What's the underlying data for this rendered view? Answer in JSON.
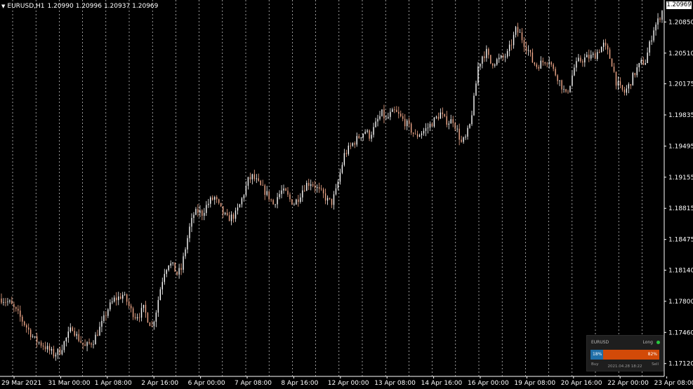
{
  "header": {
    "arrow_icon": "triangle-down-icon",
    "symbol": "EURUSD,H1",
    "open": "1.20990",
    "high": "1.20996",
    "low": "1.20937",
    "close": "1.20969"
  },
  "current_price": "1.20969",
  "colors": {
    "background": "#000000",
    "bull_candle": "#ffffff",
    "bear_candle": "#f2a98a",
    "grid": "#ffffff",
    "buy_bar": "#1f6fa8",
    "sell_bar": "#d24a08",
    "long_dot": "#27c93f"
  },
  "widget": {
    "symbol": "EURUSD",
    "signal_label": "Long",
    "buy_pct": "18%",
    "sell_pct": "82%",
    "buy_fraction": 0.18,
    "buy_label": "Buy",
    "sell_label": "Sell",
    "timestamp": "2021.04.28 18:22"
  },
  "chart_data": {
    "type": "candlestick",
    "symbol": "EURUSD",
    "timeframe": "H1",
    "ylim": [
      1.1698,
      1.2109
    ],
    "grid": "vertical dotted",
    "y_ticks": [
      "1.20850",
      "1.20510",
      "1.20175",
      "1.19835",
      "1.19495",
      "1.19155",
      "1.18815",
      "1.18475",
      "1.18140",
      "1.17800",
      "1.17460",
      "1.17120"
    ],
    "x_ticks": [
      "29 Mar 2021",
      "31 Mar 00:00",
      "1 Apr 08:00",
      "2 Apr 16:00",
      "6 Apr 00:00",
      "7 Apr 08:00",
      "8 Apr 16:00",
      "12 Apr 00:00",
      "13 Apr 08:00",
      "14 Apr 16:00",
      "16 Apr 00:00",
      "19 Apr 08:00",
      "20 Apr 16:00",
      "22 Apr 00:00",
      "23 Apr 08:00"
    ],
    "close_path": [
      [
        0,
        1.1783
      ],
      [
        4,
        1.1778
      ],
      [
        8,
        1.1766
      ],
      [
        12,
        1.1752
      ],
      [
        16,
        1.1738
      ],
      [
        20,
        1.1732
      ],
      [
        25,
        1.1722
      ],
      [
        28,
        1.1726
      ],
      [
        30,
        1.1735
      ],
      [
        34,
        1.1752
      ],
      [
        36,
        1.1742
      ],
      [
        40,
        1.173
      ],
      [
        44,
        1.1737
      ],
      [
        48,
        1.1755
      ],
      [
        51,
        1.1772
      ],
      [
        54,
        1.1782
      ],
      [
        56,
        1.1784
      ],
      [
        58,
        1.1787
      ],
      [
        60,
        1.178
      ],
      [
        62,
        1.177
      ],
      [
        64,
        1.1764
      ],
      [
        66,
        1.1766
      ],
      [
        68,
        1.1772
      ],
      [
        70,
        1.1761
      ],
      [
        72,
        1.1752
      ],
      [
        74,
        1.177
      ],
      [
        76,
        1.1794
      ],
      [
        78,
        1.1813
      ],
      [
        80,
        1.1822
      ],
      [
        82,
        1.1818
      ],
      [
        84,
        1.181
      ],
      [
        86,
        1.1815
      ],
      [
        88,
        1.1838
      ],
      [
        90,
        1.186
      ],
      [
        92,
        1.1875
      ],
      [
        94,
        1.1878
      ],
      [
        96,
        1.1876
      ],
      [
        98,
        1.1884
      ],
      [
        100,
        1.189
      ],
      [
        102,
        1.1893
      ],
      [
        104,
        1.1884
      ],
      [
        106,
        1.1876
      ],
      [
        108,
        1.187
      ],
      [
        110,
        1.1872
      ],
      [
        112,
        1.1875
      ],
      [
        114,
        1.1885
      ],
      [
        116,
        1.1898
      ],
      [
        118,
        1.1912
      ],
      [
        120,
        1.1916
      ],
      [
        122,
        1.1911
      ],
      [
        124,
        1.1905
      ],
      [
        126,
        1.19
      ],
      [
        128,
        1.1894
      ],
      [
        130,
        1.1886
      ],
      [
        132,
        1.1894
      ],
      [
        134,
        1.19
      ],
      [
        136,
        1.1898
      ],
      [
        138,
        1.1891
      ],
      [
        140,
        1.1887
      ],
      [
        142,
        1.1893
      ],
      [
        144,
        1.1902
      ],
      [
        146,
        1.1908
      ],
      [
        148,
        1.191
      ],
      [
        150,
        1.1906
      ],
      [
        152,
        1.19
      ],
      [
        154,
        1.1896
      ],
      [
        156,
        1.189
      ],
      [
        158,
        1.1888
      ],
      [
        160,
        1.19
      ],
      [
        162,
        1.192
      ],
      [
        164,
        1.194
      ],
      [
        166,
        1.1946
      ],
      [
        168,
        1.1952
      ],
      [
        170,
        1.1957
      ],
      [
        172,
        1.1962
      ],
      [
        174,
        1.1966
      ],
      [
        176,
        1.1961
      ],
      [
        178,
        1.1968
      ],
      [
        180,
        1.1978
      ],
      [
        182,
        1.1985
      ],
      [
        184,
        1.1978
      ],
      [
        186,
        1.1984
      ],
      [
        188,
        1.1987
      ],
      [
        190,
        1.1983
      ],
      [
        192,
        1.1978
      ],
      [
        194,
        1.1973
      ],
      [
        196,
        1.1967
      ],
      [
        198,
        1.196
      ],
      [
        200,
        1.1963
      ],
      [
        202,
        1.1966
      ],
      [
        204,
        1.197
      ],
      [
        206,
        1.1975
      ],
      [
        208,
        1.198
      ],
      [
        210,
        1.1985
      ],
      [
        212,
        1.1978
      ],
      [
        214,
        1.1976
      ],
      [
        216,
        1.1978
      ],
      [
        218,
        1.1966
      ],
      [
        220,
        1.1953
      ],
      [
        222,
        1.1958
      ],
      [
        224,
        1.1972
      ],
      [
        226,
        1.2
      ],
      [
        228,
        1.2036
      ],
      [
        230,
        1.2048
      ],
      [
        232,
        1.2052
      ],
      [
        234,
        1.204
      ],
      [
        236,
        1.2042
      ],
      [
        238,
        1.2044
      ],
      [
        240,
        1.2046
      ],
      [
        242,
        1.205
      ],
      [
        244,
        1.2062
      ],
      [
        246,
        1.2076
      ],
      [
        248,
        1.2072
      ],
      [
        250,
        1.2062
      ],
      [
        252,
        1.2054
      ],
      [
        254,
        1.2042
      ],
      [
        256,
        1.2037
      ],
      [
        258,
        1.204
      ],
      [
        260,
        1.2043
      ],
      [
        262,
        1.2044
      ],
      [
        264,
        1.2032
      ],
      [
        266,
        1.2025
      ],
      [
        268,
        1.2015
      ],
      [
        270,
        1.2005
      ],
      [
        272,
        1.2018
      ],
      [
        274,
        1.2035
      ],
      [
        276,
        1.2042
      ],
      [
        278,
        1.2044
      ],
      [
        280,
        1.2046
      ],
      [
        282,
        1.2047
      ],
      [
        284,
        1.2049
      ],
      [
        286,
        1.2055
      ],
      [
        288,
        1.206
      ],
      [
        290,
        1.2052
      ],
      [
        292,
        1.204
      ],
      [
        294,
        1.202
      ],
      [
        296,
        1.2012
      ],
      [
        298,
        1.2008
      ],
      [
        300,
        1.2015
      ],
      [
        302,
        1.2025
      ],
      [
        304,
        1.2034
      ],
      [
        306,
        1.204
      ],
      [
        308,
        1.2042
      ],
      [
        310,
        1.206
      ],
      [
        312,
        1.2078
      ],
      [
        314,
        1.2086
      ],
      [
        316,
        1.2097
      ]
    ]
  }
}
